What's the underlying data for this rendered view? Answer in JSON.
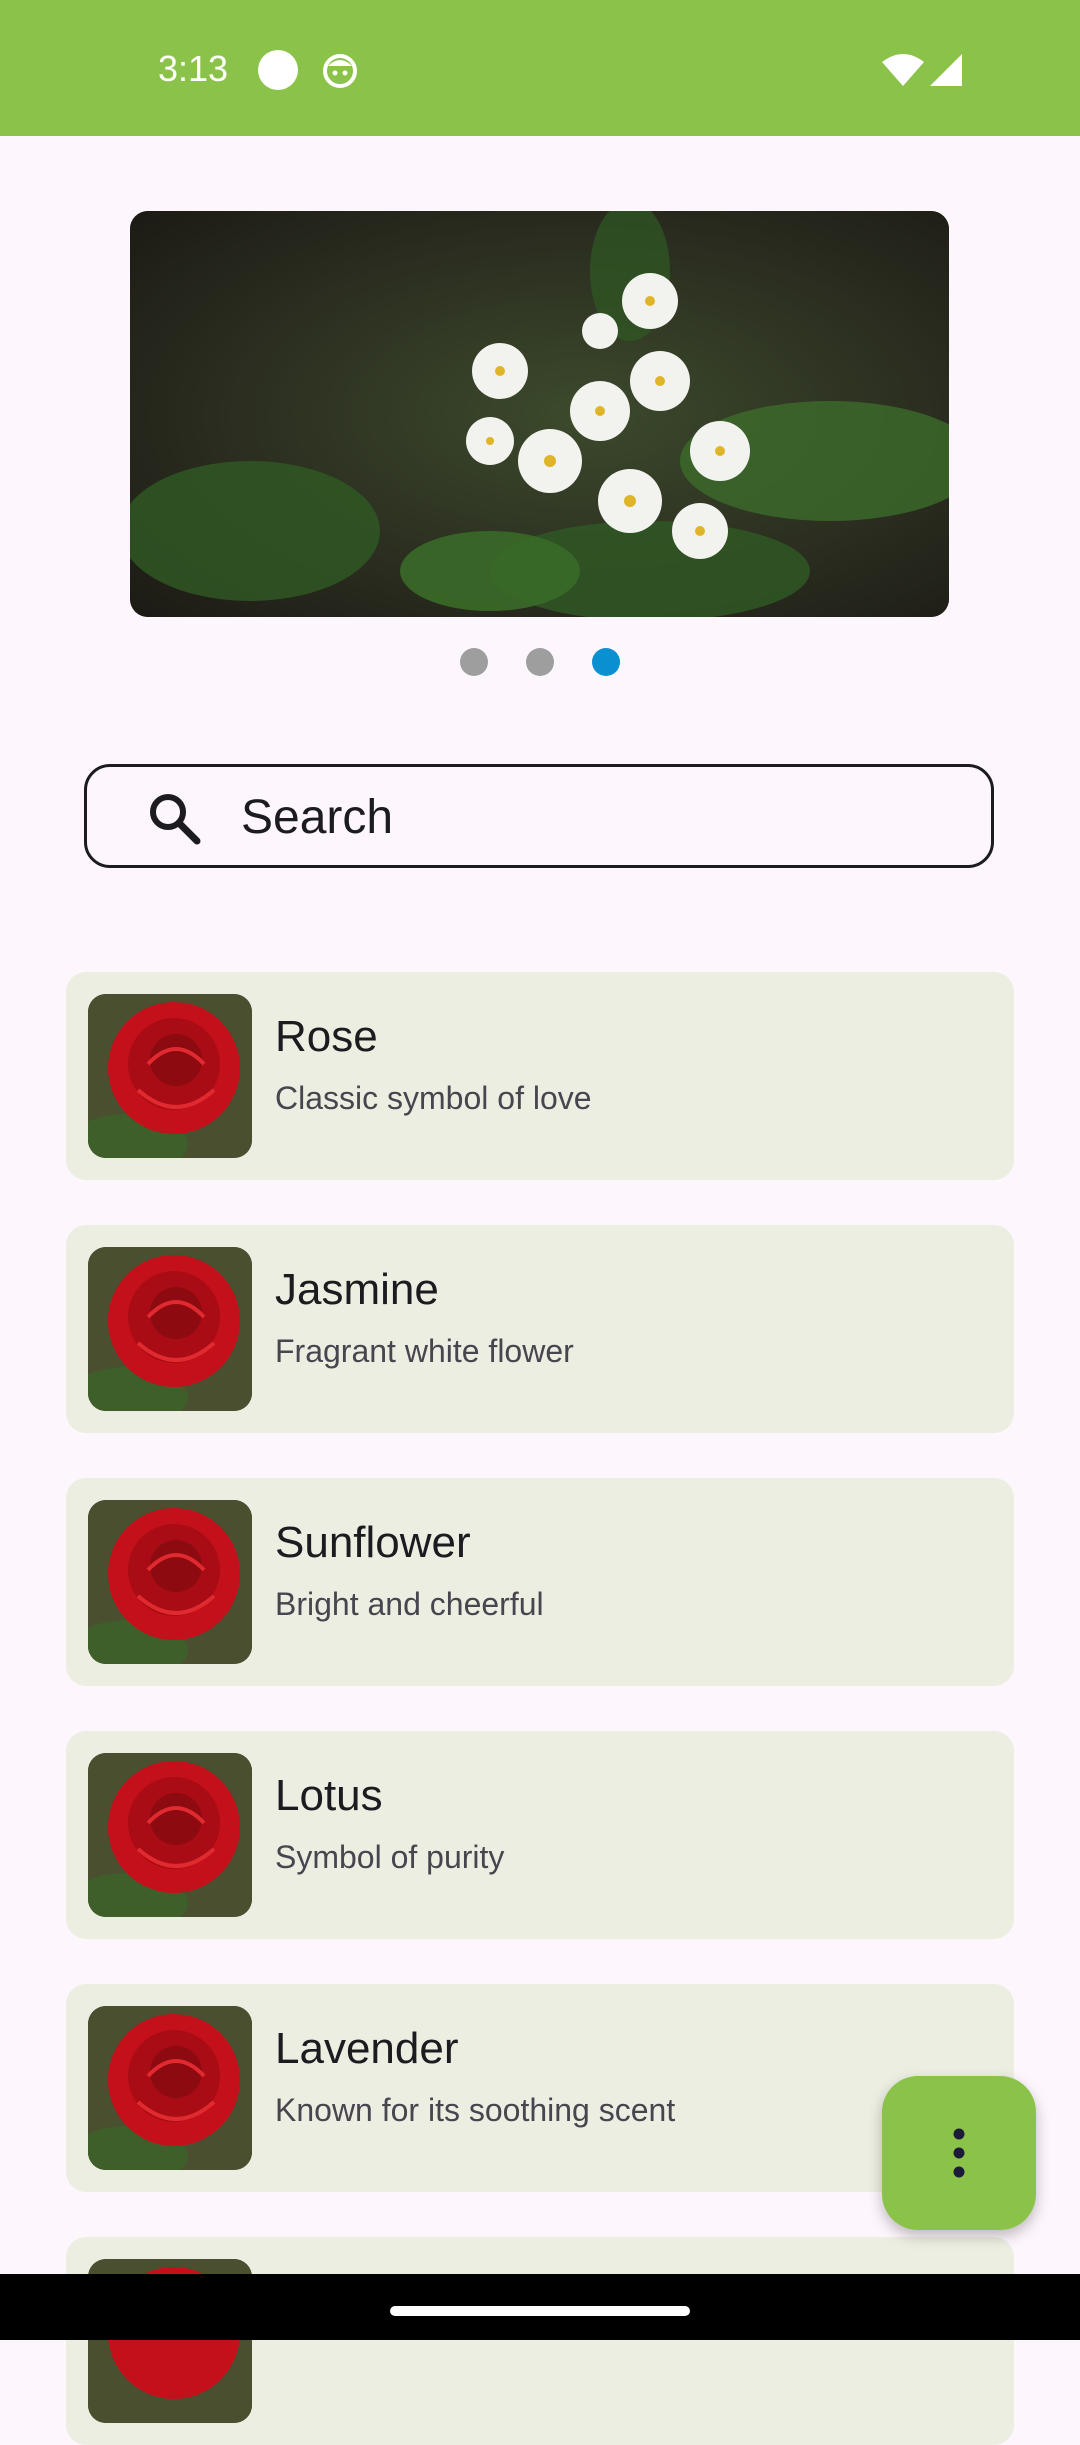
{
  "status_bar": {
    "time": "3:13",
    "background": "#8bc34a",
    "icons": [
      "circle-icon",
      "face-icon",
      "wifi-icon",
      "signal-icon"
    ]
  },
  "carousel": {
    "image": "white-flowers-image",
    "pages": 3,
    "active_page": 3,
    "active_color": "#0a8fd1",
    "inactive_color": "#9e9e9e"
  },
  "search": {
    "placeholder": "Search",
    "icon": "search-icon"
  },
  "flowers": [
    {
      "name": "Rose",
      "description": "Classic symbol of love"
    },
    {
      "name": "Jasmine",
      "description": "Fragrant white flower"
    },
    {
      "name": "Sunflower",
      "description": "Bright and cheerful"
    },
    {
      "name": "Lotus",
      "description": "Symbol of purity"
    },
    {
      "name": "Lavender",
      "description": "Known for its soothing scent"
    },
    {
      "name": "",
      "description": ""
    }
  ],
  "fab": {
    "icon": "more-vert-icon",
    "color": "#8bc34a"
  },
  "colors": {
    "card_background": "#eceee2",
    "page_background": "#fdf6fc"
  }
}
